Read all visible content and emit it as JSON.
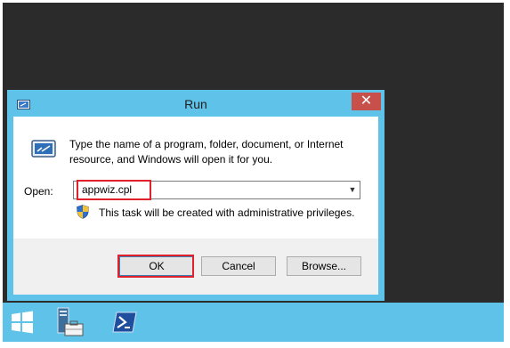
{
  "dialog": {
    "title": "Run",
    "close_glyph": "✕",
    "description": "Type the name of a program, folder, document, or Internet resource, and Windows will open it for you.",
    "open_label": "Open:",
    "open_value": "appwiz.cpl",
    "admin_note": "This task will be created with administrative privileges.",
    "buttons": {
      "ok": "OK",
      "cancel": "Cancel",
      "browse": "Browse..."
    }
  },
  "icons": {
    "title": "run-icon",
    "body": "run-icon",
    "shield": "uac-shield-icon",
    "dropdown": "chevron-down-icon"
  },
  "taskbar": {
    "items": [
      "start-button",
      "server-manager",
      "powershell"
    ]
  },
  "colors": {
    "accent": "#5fc2e8",
    "desktop": "#2b2b2b",
    "highlight": "#e0202a",
    "close": "#c7504a"
  }
}
